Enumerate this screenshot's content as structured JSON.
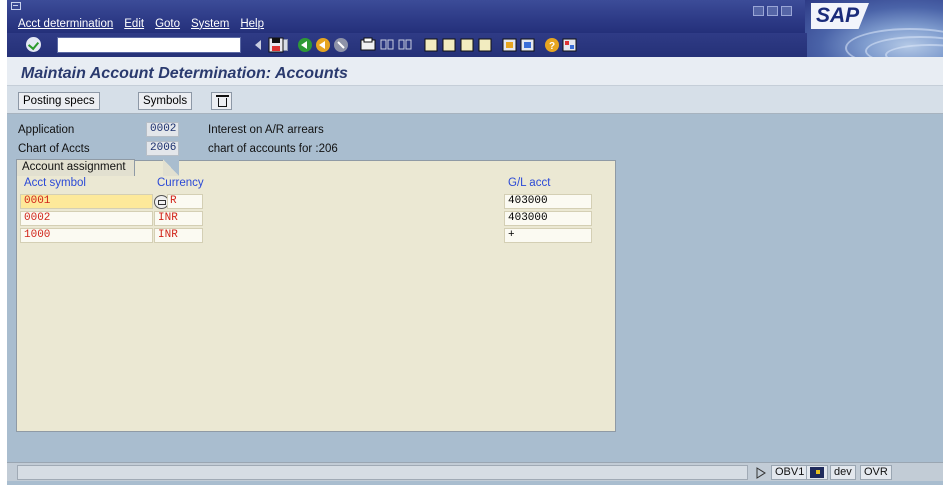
{
  "menu": [
    "Acct determination",
    "Edit",
    "Goto",
    "System",
    "Help"
  ],
  "brand": "SAP",
  "title": "Maintain Account Determination: Accounts",
  "app_toolbar": {
    "posting_specs": "Posting specs",
    "symbols": "Symbols"
  },
  "header": {
    "application_label": "Application",
    "application_value": "0002",
    "application_desc": "Interest on A/R arrears",
    "chart_label": "Chart of Accts",
    "chart_value": "2006",
    "chart_desc": "chart of accounts for :206"
  },
  "panel": {
    "tab_label": "Account assignment",
    "columns": {
      "acct_symbol": "Acct symbol",
      "currency": "Currency",
      "gl_acct": "G/L acct"
    },
    "rows": [
      {
        "acct_symbol": "0001",
        "currency": "R",
        "gl_acct": "403000"
      },
      {
        "acct_symbol": "0002",
        "currency": "INR",
        "gl_acct": "403000"
      },
      {
        "acct_symbol": "1000",
        "currency": "INR",
        "gl_acct": "+"
      }
    ]
  },
  "status": {
    "transaction": "OBV1",
    "system": "dev",
    "mode": "OVR"
  },
  "colors": {
    "menubar": "#2d3a86",
    "background": "#a9bdcf",
    "panel": "#ebe8d3",
    "title": "#2a3a6e",
    "column_header": "#2b49d6",
    "key_values": "#d1251a",
    "selected_cell": "#fde99a"
  }
}
